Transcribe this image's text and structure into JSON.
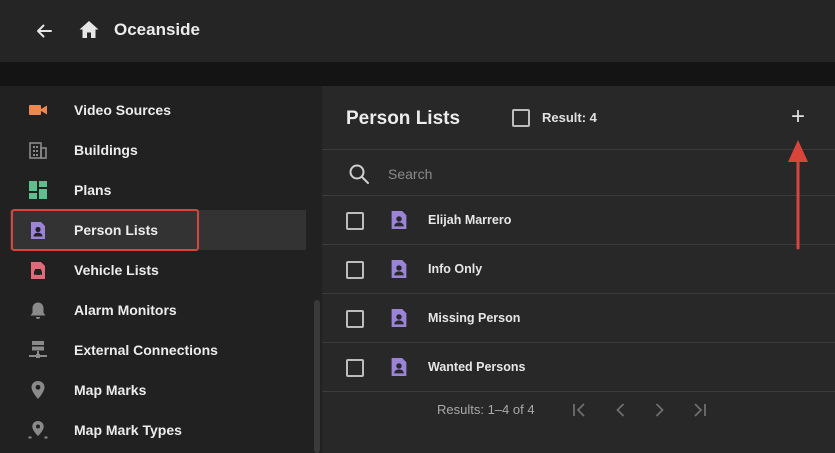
{
  "header": {
    "title": "Oceanside",
    "back_icon": "arrow-left-icon",
    "home_icon": "home-icon"
  },
  "sidebar": {
    "items": [
      {
        "label": "Video Sources",
        "icon": "video-camera-icon",
        "color": "#f0874f"
      },
      {
        "label": "Buildings",
        "icon": "building-icon",
        "color": "#8a8a8a"
      },
      {
        "label": "Plans",
        "icon": "plans-icon",
        "color": "#5cbf8e"
      },
      {
        "label": "Person Lists",
        "icon": "person-list-icon",
        "color": "#9b84d6",
        "active": true
      },
      {
        "label": "Vehicle Lists",
        "icon": "vehicle-list-icon",
        "color": "#e06a7a"
      },
      {
        "label": "Alarm Monitors",
        "icon": "bell-icon",
        "color": "#8a8a8a"
      },
      {
        "label": "External Connections",
        "icon": "network-icon",
        "color": "#8a8a8a"
      },
      {
        "label": "Map Marks",
        "icon": "map-pin-icon",
        "color": "#8a8a8a"
      },
      {
        "label": "Map Mark Types",
        "icon": "map-pin-type-icon",
        "color": "#8a8a8a"
      }
    ]
  },
  "panel": {
    "title": "Person Lists",
    "result_label": "Result: 4",
    "add_label": "+",
    "search": {
      "placeholder": "Search",
      "value": ""
    },
    "rows": [
      {
        "label": "Elijah Marrero"
      },
      {
        "label": "Info Only"
      },
      {
        "label": "Missing Person"
      },
      {
        "label": "Wanted Persons"
      }
    ],
    "pagination": {
      "text": "Results: 1–4 of 4"
    }
  },
  "colors": {
    "accent_person": "#9b84d6",
    "highlight_red": "#d9443b",
    "background": "#1f1f1f"
  }
}
